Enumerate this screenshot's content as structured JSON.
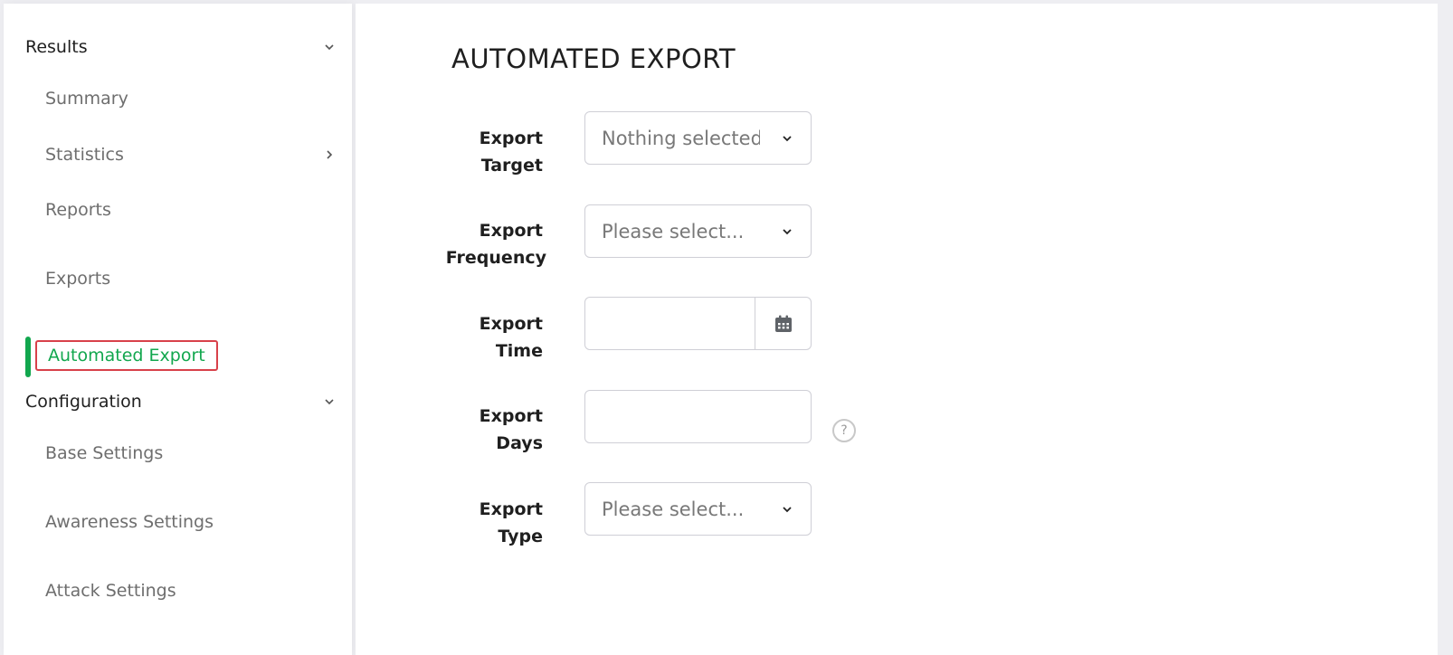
{
  "sidebar": {
    "results": {
      "header": "Results",
      "items": [
        {
          "label": "Summary"
        },
        {
          "label": "Statistics"
        },
        {
          "label": "Reports"
        },
        {
          "label": "Exports"
        },
        {
          "label": "Automated Export"
        }
      ]
    },
    "configuration": {
      "header": "Configuration",
      "items": [
        {
          "label": "Base Settings"
        },
        {
          "label": "Awareness Settings"
        },
        {
          "label": "Attack Settings"
        }
      ]
    }
  },
  "main": {
    "title": "AUTOMATED EXPORT",
    "form": {
      "export_target": {
        "label_line1": "Export",
        "label_line2": "Target",
        "value": "Nothing selected"
      },
      "export_frequency": {
        "label_line1": "Export",
        "label_line2": "Frequency",
        "placeholder": "Please select..."
      },
      "export_time": {
        "label_line1": "Export",
        "label_line2": "Time",
        "value": ""
      },
      "export_days": {
        "label_line1": "Export",
        "label_line2": "Days",
        "value": ""
      },
      "export_type": {
        "label_line1": "Export",
        "label_line2": "Type",
        "placeholder": "Please select..."
      }
    },
    "help_icon_text": "?"
  },
  "colors": {
    "accent": "#12a74e",
    "highlight_border": "#d8414a",
    "text_primary": "#1f1f1f",
    "text_muted": "#6e6e6e"
  }
}
